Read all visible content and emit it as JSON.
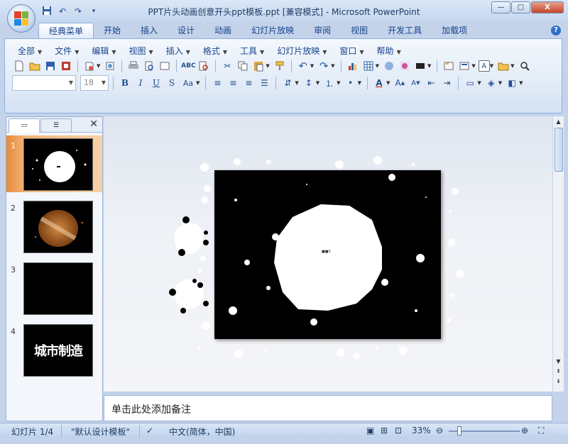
{
  "window": {
    "title": "PPT片头动画创意开头ppt模板.ppt [兼容模式] - Microsoft PowerPoint",
    "buttons": {
      "minimize": "—",
      "maximize": "□",
      "close": "X"
    }
  },
  "quick_access": {
    "icons": [
      "save-icon",
      "undo-icon",
      "redo-icon",
      "customize-qat-icon"
    ]
  },
  "ribbon_tabs": [
    "经典菜单",
    "开始",
    "插入",
    "设计",
    "动画",
    "幻灯片放映",
    "审阅",
    "视图",
    "开发工具",
    "加载项"
  ],
  "active_tab": "经典菜单",
  "classic_menu": [
    "全部",
    "文件",
    "编辑",
    "视图",
    "插入",
    "格式",
    "工具",
    "幻灯片放映",
    "窗口",
    "帮助"
  ],
  "toolbar": {
    "font_name": "",
    "font_size": "18",
    "format_buttons": [
      "B",
      "I",
      "U",
      "S",
      "Aa"
    ]
  },
  "slides": [
    {
      "number": "1",
      "selected": true
    },
    {
      "number": "2",
      "selected": false
    },
    {
      "number": "3",
      "selected": false
    },
    {
      "number": "4",
      "selected": false,
      "text": "城市制造"
    }
  ],
  "main_slide": {
    "center_label": "■■X"
  },
  "notes": {
    "placeholder": "单击此处添加备注"
  },
  "statusbar": {
    "slide_info": "幻灯片 1/4",
    "theme": "\"默认设计模板\"",
    "language": "中文(简体，中国)",
    "zoom": "33%"
  },
  "colors": {
    "accent": "#e78a3b",
    "ribbon": "#dfe9f6",
    "brand": "#15428b"
  }
}
